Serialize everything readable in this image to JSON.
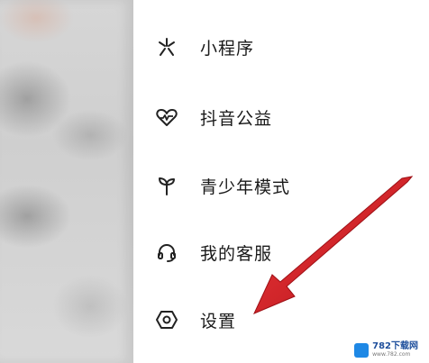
{
  "menu": {
    "items": [
      {
        "label": "小程序",
        "icon": "mini-program-icon"
      },
      {
        "label": "抖音公益",
        "icon": "charity-heart-icon"
      },
      {
        "label": "青少年模式",
        "icon": "sprout-icon"
      },
      {
        "label": "我的客服",
        "icon": "headset-icon"
      },
      {
        "label": "设置",
        "icon": "settings-hexagon-icon"
      }
    ]
  },
  "watermark": {
    "title": "782下载网",
    "subtitle": "www.782.com"
  },
  "colors": {
    "arrow": "#d31f28",
    "text": "#1a1a1a",
    "icon": "#222222"
  }
}
